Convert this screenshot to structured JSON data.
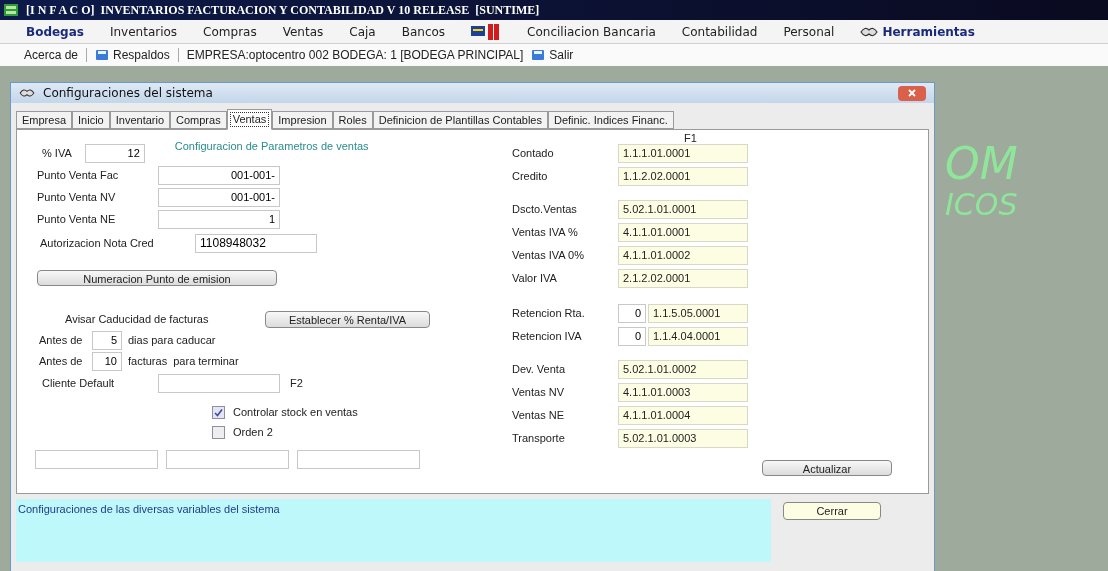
{
  "window": {
    "title": "[I N F A C O]  INVENTARIOS FACTURACION Y CONTABILIDAD V 10 RELEASE  [SUNTIME]"
  },
  "menu": [
    {
      "label": "Bodegas",
      "kind": "strong"
    },
    {
      "label": "Inventarios",
      "kind": "plain"
    },
    {
      "label": "Compras",
      "kind": "plain"
    },
    {
      "label": "Ventas",
      "kind": "plain"
    },
    {
      "label": "Caja",
      "kind": "plain"
    },
    {
      "label": "Bancos",
      "kind": "plain"
    },
    {
      "kind": "logo"
    },
    {
      "label": "Conciliacion Bancaria",
      "kind": "plain"
    },
    {
      "label": "Contabilidad",
      "kind": "plain"
    },
    {
      "label": "Personal",
      "kind": "plain"
    },
    {
      "label": "Herramientas",
      "kind": "icon-strong"
    }
  ],
  "toolbar": [
    {
      "label": "Acerca de",
      "kind": "button"
    },
    {
      "label": "Respaldos",
      "kind": "icon-button"
    },
    {
      "label": "EMPRESA:optocentro 002  BODEGA: 1 [BODEGA PRINCIPAL]",
      "kind": "info"
    },
    {
      "label": "Salir",
      "kind": "icon-button"
    }
  ],
  "wallpaper": [
    "OM",
    "ICOS"
  ],
  "dialog": {
    "title": "Configuraciones del sistema",
    "tabs": [
      {
        "label": "Empresa",
        "selected": false
      },
      {
        "label": "Inicio",
        "selected": false
      },
      {
        "label": "Inventario",
        "selected": false
      },
      {
        "label": "Compras",
        "selected": false
      },
      {
        "label": "Ventas",
        "selected": true
      },
      {
        "label": "Impresion",
        "selected": false
      },
      {
        "label": "Roles",
        "selected": false
      },
      {
        "label": "Definicion de Plantillas Contables",
        "selected": false
      },
      {
        "label": "Definic. Indices Financ.",
        "selected": false
      }
    ],
    "heading": "Configuracion de Parametros de ventas",
    "iva": {
      "label": "% IVA",
      "value": "12"
    },
    "puntos": [
      {
        "label": "Punto Venta Fac",
        "value": "001-001-"
      },
      {
        "label": "Punto Venta NV",
        "value": "001-001-"
      },
      {
        "label": "Punto Venta NE",
        "value": "1"
      }
    ],
    "autorizacion": {
      "label": "Autorizacion Nota Cred",
      "value": "1108948032"
    },
    "numeracion_button": "Numeracion Punto de emision",
    "avisar": {
      "label": "Avisar Caducidad de facturas",
      "button": "Establecer % Renta/IVA"
    },
    "antes": [
      {
        "label": "Antes de",
        "value": "5",
        "suffix": "dias para caducar"
      },
      {
        "label": "Antes de",
        "value": "10",
        "suffix": "facturas  para terminar"
      }
    ],
    "cliente": {
      "label": "Cliente Default",
      "hint": "F2"
    },
    "checks": [
      {
        "label": "Controlar stock en ventas",
        "checked": true
      },
      {
        "label": "Orden 2",
        "checked": false
      }
    ],
    "accounts_hint": "F1",
    "account_groups": [
      [
        {
          "label": "Contado",
          "value": "1.1.1.01.0001"
        },
        {
          "label": "Credito",
          "value": "1.1.2.02.0001"
        }
      ],
      [
        {
          "label": "Dscto.Ventas",
          "value": "5.02.1.01.0001"
        },
        {
          "label": "Ventas IVA %",
          "value": "4.1.1.01.0001"
        },
        {
          "label": "Ventas IVA 0%",
          "value": "4.1.1.01.0002"
        },
        {
          "label": "Valor IVA",
          "value": "2.1.2.02.0001"
        }
      ],
      [
        {
          "label": "Retencion Rta.",
          "percent": "0",
          "value": "1.1.5.05.0001"
        },
        {
          "label": "Retencion IVA",
          "percent": "0",
          "value": "1.1.4.04.0001"
        }
      ],
      [
        {
          "label": "Dev. Venta",
          "value": "5.02.1.01.0002"
        },
        {
          "label": "Ventas NV",
          "value": "4.1.1.01.0003"
        },
        {
          "label": "Ventas NE",
          "value": "4.1.1.01.0004"
        },
        {
          "label": "Transporte",
          "value": "5.02.1.01.0003"
        }
      ]
    ],
    "update_button": "Actualizar",
    "status_text": "Configuraciones de las diversas variables del sistema",
    "close_button": "Cerrar"
  }
}
